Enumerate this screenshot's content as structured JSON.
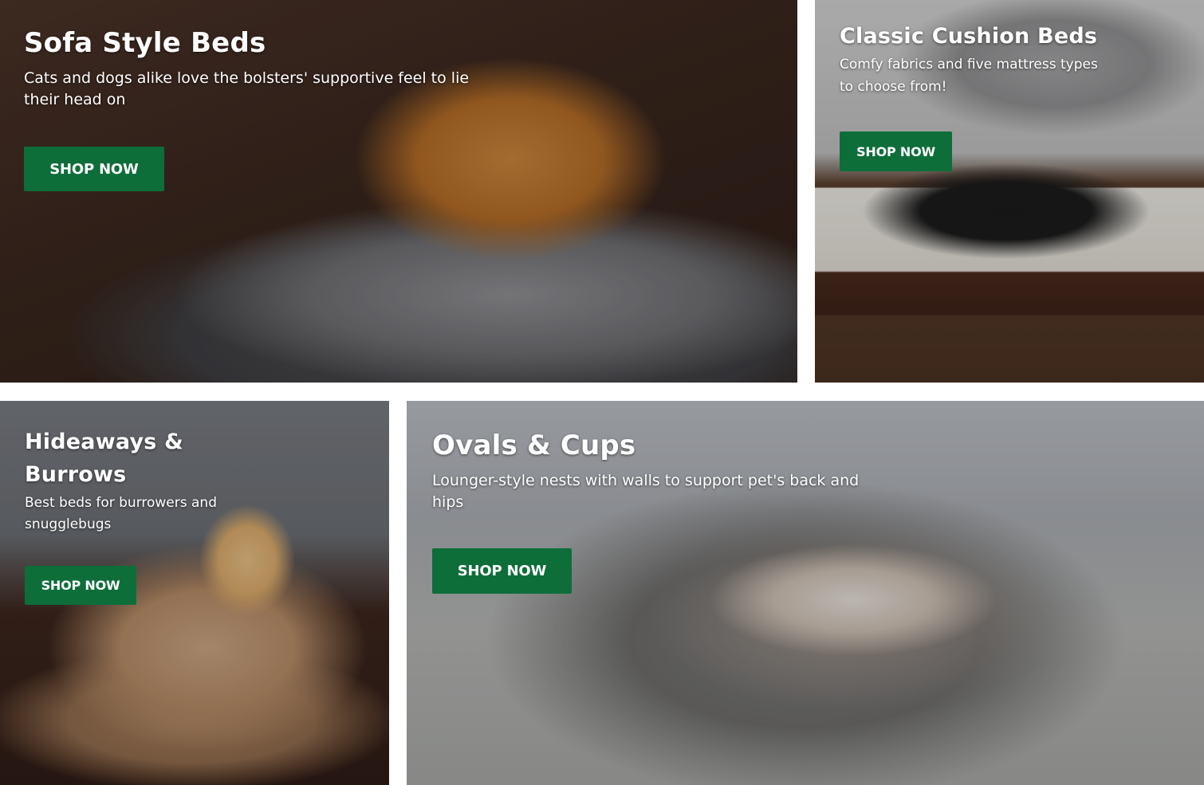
{
  "tiles": [
    {
      "title": "Sofa Style Beds",
      "description": "Cats and dogs alike love the bolsters' supportive feel to lie their head on",
      "button_label": "SHOP NOW"
    },
    {
      "title": "Classic Cushion Beds",
      "description": "Comfy fabrics and five mattress types to choose from!",
      "button_label": "SHOP NOW"
    },
    {
      "title": "Hideaways & Burrows",
      "description": "Best beds for burrowers and snugglebugs",
      "button_label": "SHOP NOW"
    },
    {
      "title": "Ovals & Cups",
      "description": "Lounger-style nests with walls to support pet's back and hips",
      "button_label": "SHOP NOW"
    }
  ],
  "colors": {
    "button_bg": "#0d6e3a",
    "text": "#ffffff"
  }
}
